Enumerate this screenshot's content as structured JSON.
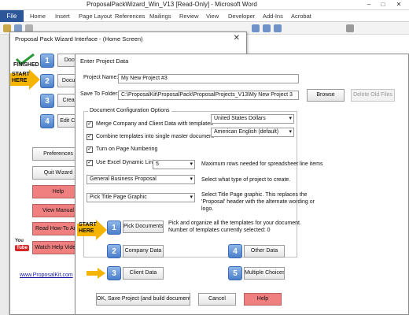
{
  "word": {
    "title": "ProposalPackWizard_Win_V13 [Read-Only] - Microsoft Word",
    "controls": [
      "–",
      "□",
      "✕"
    ],
    "tabs": [
      "File",
      "Home",
      "Insert",
      "Page Layout",
      "References",
      "Mailings",
      "Review",
      "View",
      "Developer",
      "Add-Ins",
      "Acrobat"
    ]
  },
  "wizard": {
    "title": "Proposal Pack Wizard Interface - (Home Screen)",
    "close": "✕",
    "finished_badge": "FINISHED",
    "start_here_badge": "START HERE",
    "steps": [
      {
        "num": "1",
        "label": "Docu"
      },
      {
        "num": "2",
        "label": "Docum"
      },
      {
        "num": "3",
        "label": "Create"
      },
      {
        "num": "4",
        "label": "Edit Curr"
      }
    ],
    "side_buttons": [
      {
        "label": "Preferences",
        "style": "normal"
      },
      {
        "label": "Quit Wizard",
        "style": "normal"
      },
      {
        "label": "Help",
        "style": "red"
      },
      {
        "label": "View Manual",
        "style": "red"
      },
      {
        "label": "Read How-To Artic",
        "style": "red"
      },
      {
        "label": "Watch Help Videos",
        "style": "red"
      }
    ],
    "youtube": {
      "you": "You",
      "tube": "Tube"
    },
    "link": "www.ProposalKit.com"
  },
  "dialog": {
    "title": "Enter Project Data",
    "project_name_label": "Project Name:",
    "project_name_value": "My New Project #3",
    "save_to_label": "Save To Folder:",
    "save_to_value": "C:\\ProposalKit\\ProposalPack\\ProposalProjects_V13\\My New Project 3",
    "browse_label": "Browse",
    "delete_label": "Delete Old Files",
    "group_title": "Document Configuration Options",
    "options": [
      {
        "label": "Merge Company and Client Data with templates",
        "checked": true
      },
      {
        "label": "Combine templates into single master document",
        "checked": true
      },
      {
        "label": "Turn on Page Numbering",
        "checked": true
      },
      {
        "label": "Use Excel Dynamic Links",
        "checked": true
      }
    ],
    "currency": "United States Dollars",
    "language": "American English (default)",
    "excel_rows": "5",
    "excel_rows_hint": "Maximum rows needed for spreadsheet line items",
    "project_type": "General Business Proposal",
    "project_type_hint": "Select what type of project to create.",
    "title_graphic": "Pick Title Page Graphic",
    "title_graphic_hint": "Select Title Page graphic. This replaces the 'Proposal' header with the alternate wording or logo.",
    "start_here_badge": "START HERE",
    "tiles": [
      {
        "num": "1",
        "label": "Pick Documents"
      },
      {
        "num": "2",
        "label": "Company Data"
      },
      {
        "num": "3",
        "label": "Client Data"
      },
      {
        "num": "4",
        "label": "Other Data"
      },
      {
        "num": "5",
        "label": "Multiple Choices"
      }
    ],
    "pick_hint": "Pick and organize all the templates for your document.",
    "pick_count": "Number of templates currently selected: 0",
    "ok_label": "OK, Save Project (and build documents)",
    "cancel_label": "Cancel",
    "help_label": "Help"
  },
  "colors": {
    "file_tab": "#2b579a",
    "red_button": "#f08080",
    "tile_blue": "#4b7fcb",
    "arrow_yellow": "#f5b400"
  }
}
